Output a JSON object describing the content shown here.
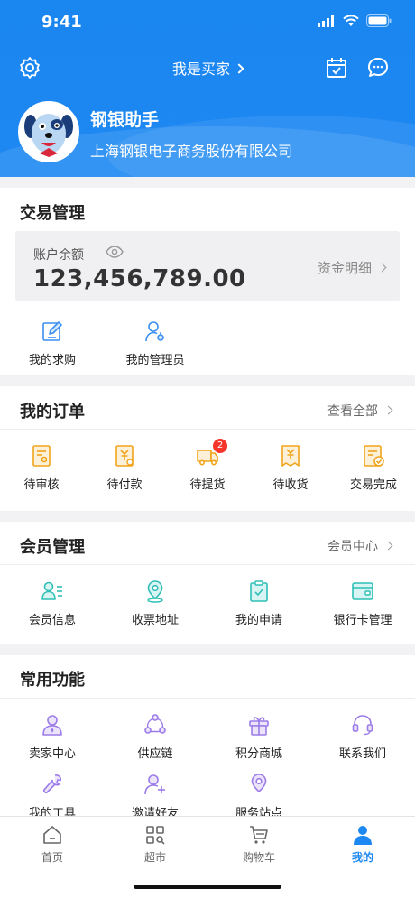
{
  "status_bar": {
    "time": "9:41"
  },
  "nav": {
    "title": "我是买家"
  },
  "profile": {
    "name": "钢银助手",
    "company": "上海钢银电子商务股份有限公司"
  },
  "trade": {
    "title": "交易管理",
    "balance_label": "账户余额",
    "balance_amount": "123,456,789.00",
    "details_link": "资金明细",
    "items": [
      {
        "label": "我的求购",
        "icon": "edit-icon"
      },
      {
        "label": "我的管理员",
        "icon": "admin-icon"
      }
    ]
  },
  "orders": {
    "title": "我的订单",
    "view_all": "查看全部",
    "items": [
      {
        "label": "待审核",
        "icon": "review-icon"
      },
      {
        "label": "待付款",
        "icon": "payment-icon"
      },
      {
        "label": "待提货",
        "icon": "pickup-truck-icon",
        "badge": "2"
      },
      {
        "label": "待收货",
        "icon": "receive-icon"
      },
      {
        "label": "交易完成",
        "icon": "complete-icon"
      }
    ]
  },
  "membership": {
    "title": "会员管理",
    "center_link": "会员中心",
    "items": [
      {
        "label": "会员信息",
        "icon": "member-info-icon"
      },
      {
        "label": "收票地址",
        "icon": "location-icon"
      },
      {
        "label": "我的申请",
        "icon": "application-icon"
      },
      {
        "label": "银行卡管理",
        "icon": "bank-card-icon"
      }
    ]
  },
  "common": {
    "title": "常用功能",
    "items": [
      {
        "label": "卖家中心",
        "icon": "seller-icon"
      },
      {
        "label": "供应链",
        "icon": "supply-chain-icon"
      },
      {
        "label": "积分商城",
        "icon": "gift-icon"
      },
      {
        "label": "联系我们",
        "icon": "headset-icon"
      },
      {
        "label": "我的工具",
        "icon": "wrench-icon"
      },
      {
        "label": "邀请好友",
        "icon": "invite-icon"
      },
      {
        "label": "服务站点",
        "icon": "service-location-icon"
      }
    ]
  },
  "tabbar": [
    {
      "label": "首页",
      "icon": "home-icon"
    },
    {
      "label": "超市",
      "icon": "market-icon"
    },
    {
      "label": "购物车",
      "icon": "cart-icon"
    },
    {
      "label": "我的",
      "icon": "profile-icon",
      "active": true
    }
  ],
  "colors": {
    "brand": "#1E88F2",
    "orange": "#F5A623",
    "teal": "#3CC7C0",
    "purple": "#9B7BE8",
    "badge": "#F5342A"
  }
}
